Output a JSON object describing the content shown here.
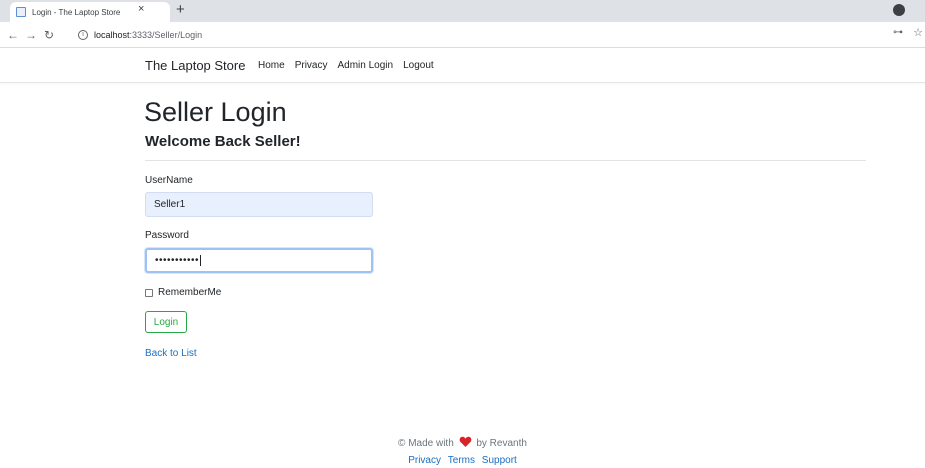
{
  "browser": {
    "tab_title": "Login - The Laptop Store",
    "tab_close": "×",
    "new_tab": "+",
    "url_host": "localhost",
    "url_path": ":3333/Seller/Login",
    "icons": [
      "back-icon",
      "forward-icon",
      "reload-icon",
      "info-icon",
      "key-icon",
      "star-icon"
    ]
  },
  "navbar": {
    "brand": "The Laptop Store",
    "links": [
      "Home",
      "Privacy",
      "Admin Login",
      "Logout"
    ]
  },
  "main": {
    "title": "Seller Login",
    "subtitle": "Welcome Back Seller!",
    "username_label": "UserName",
    "username_value": "Seller1",
    "password_label": "Password",
    "password_value": "•••••••••••",
    "remember_label": "RememberMe",
    "remember_checked": false,
    "login_button": "Login",
    "back_link": "Back to List"
  },
  "footer": {
    "made_with": "© Made with",
    "by": "by Revanth",
    "links": [
      "Privacy",
      "Terms",
      "Support"
    ]
  },
  "colors": {
    "accent_link": "#1b6ec2",
    "login_green": "#28a745",
    "autofill_bg": "#e8f0fe",
    "focus_border": "#9fc2f6",
    "heart": "#d8232a"
  }
}
